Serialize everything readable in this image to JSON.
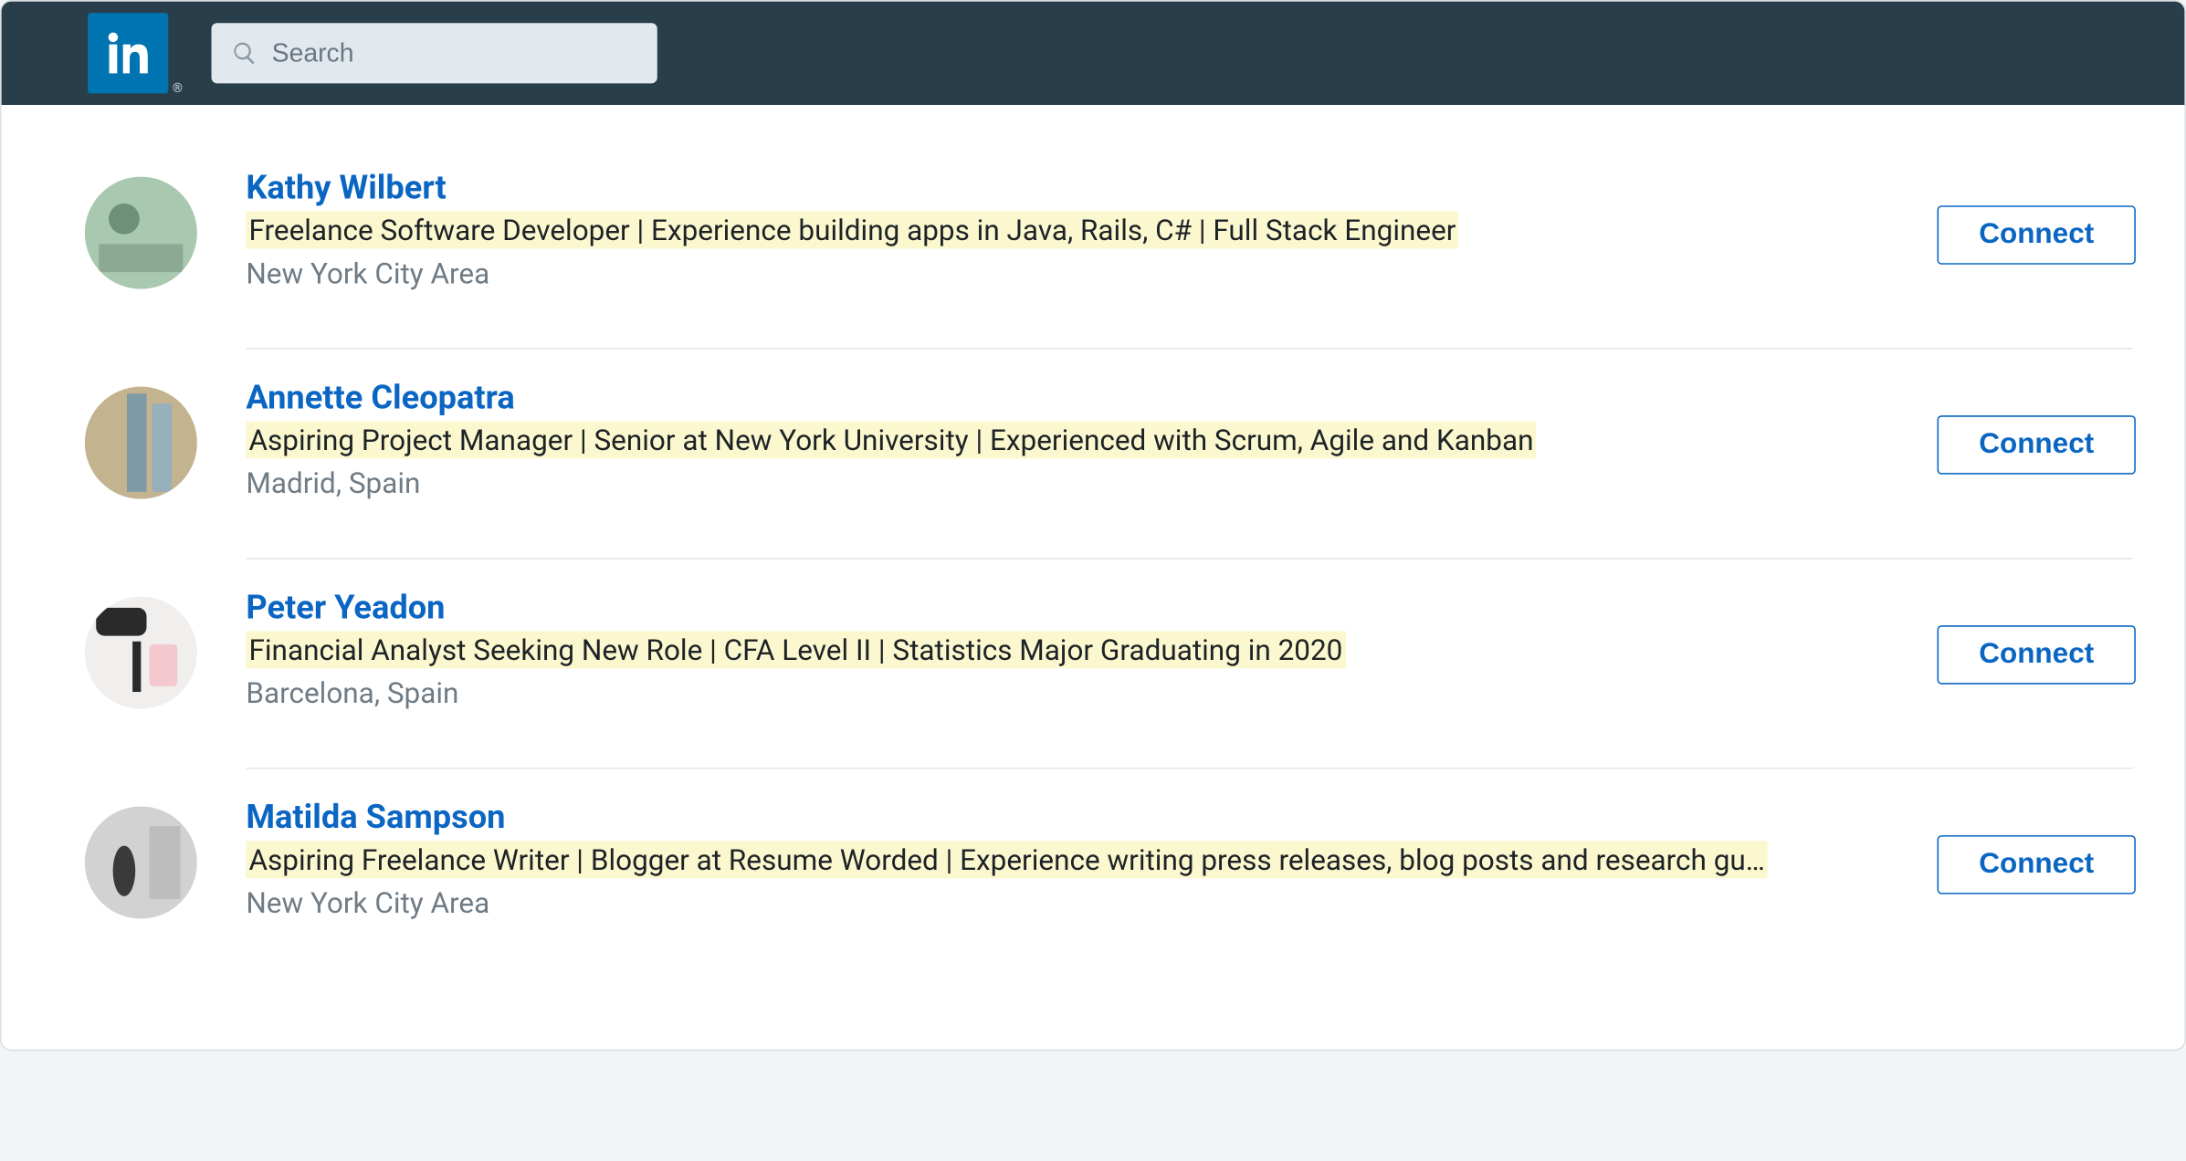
{
  "header": {
    "search_placeholder": "Search"
  },
  "connect_label": "Connect",
  "results": [
    {
      "name": "Kathy Wilbert",
      "headline": "Freelance Software Developer | Experience building apps in Java, Rails, C# | Full Stack Engineer",
      "location": "New York City Area",
      "avatar_class": "av1"
    },
    {
      "name": "Annette Cleopatra",
      "headline": "Aspiring Project Manager | Senior at New York University | Experienced with Scrum, Agile and Kanban",
      "location": "Madrid, Spain",
      "avatar_class": "av2"
    },
    {
      "name": "Peter Yeadon",
      "headline": "Financial Analyst Seeking New Role | CFA Level II | Statistics Major Graduating in 2020",
      "location": "Barcelona, Spain",
      "avatar_class": "av3"
    },
    {
      "name": "Matilda Sampson",
      "headline": "Aspiring Freelance Writer | Blogger at Resume Worded | Experience writing press releases, blog posts and research gu…",
      "location": "New York City Area",
      "avatar_class": "av4"
    }
  ]
}
